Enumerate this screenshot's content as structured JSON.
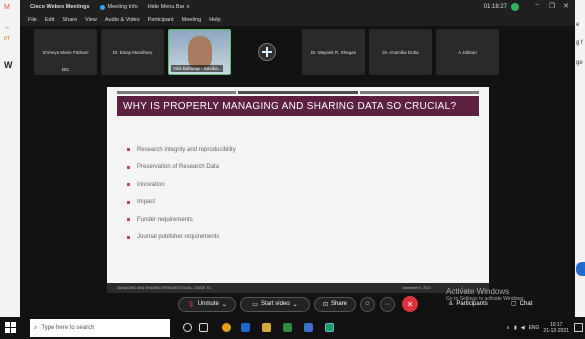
{
  "browser": {
    "left_glyphs": [
      "M",
      "←",
      "IIT",
      "W"
    ],
    "right_glyphs": [
      "e",
      "g f",
      "ge"
    ]
  },
  "titlebar": {
    "app_name": "Cisco Webex Meetings",
    "meeting_info": "Meeting Info",
    "hide_menu": "Hide Menu Bar ∧",
    "clock": "01:18:27",
    "controls": [
      "−",
      "❐",
      "✕"
    ]
  },
  "menubar": [
    "File",
    "Edit",
    "Share",
    "View",
    "Audio & Video",
    "Participant",
    "Meeting",
    "Help"
  ],
  "tiles": [
    {
      "name": "Shreeya Mane Pathare",
      "sub": "DG"
    },
    {
      "name": "Dr. Binay Mandhary",
      "sub": ""
    },
    {
      "name": "Vinit Bahurup - Saviba...",
      "sub": "Vinit Bahurup - Saviba...",
      "video": true
    },
    {
      "name": "",
      "logo": true
    },
    {
      "name": "Dr. Mayank R. Shegan",
      "sub": ""
    },
    {
      "name": "Dr. Anamika Dutta",
      "sub": ""
    },
    {
      "name": "A Jabbari",
      "sub": ""
    }
  ],
  "slide": {
    "title": "WHY IS PROPERLY MANAGING AND SHARING DATA SO CRUCIAL?",
    "bullets": [
      "Research integrity and reproducibility",
      "Preservation of Research Data",
      "Innovation",
      "Impact",
      "Funder requirements",
      "Journal publisher requirements"
    ],
    "footer_left": "MANAGING AND SHARING RESEARCH DATA - GUIDE TO",
    "footer_right": "December 5, 2021",
    "page": "2"
  },
  "controls": {
    "unmute": "Unmute",
    "start_video": "Start video",
    "share": "Share",
    "participants": "Participants",
    "chat": "Chat",
    "end_color": "#e0303a"
  },
  "activate": {
    "line1": "Activate Windows",
    "line2": "Go to Settings to activate Windows."
  },
  "taskbar": {
    "search_placeholder": "Type here to search",
    "lang": "ENG",
    "time": "10:17",
    "date": "21-12-2021"
  }
}
